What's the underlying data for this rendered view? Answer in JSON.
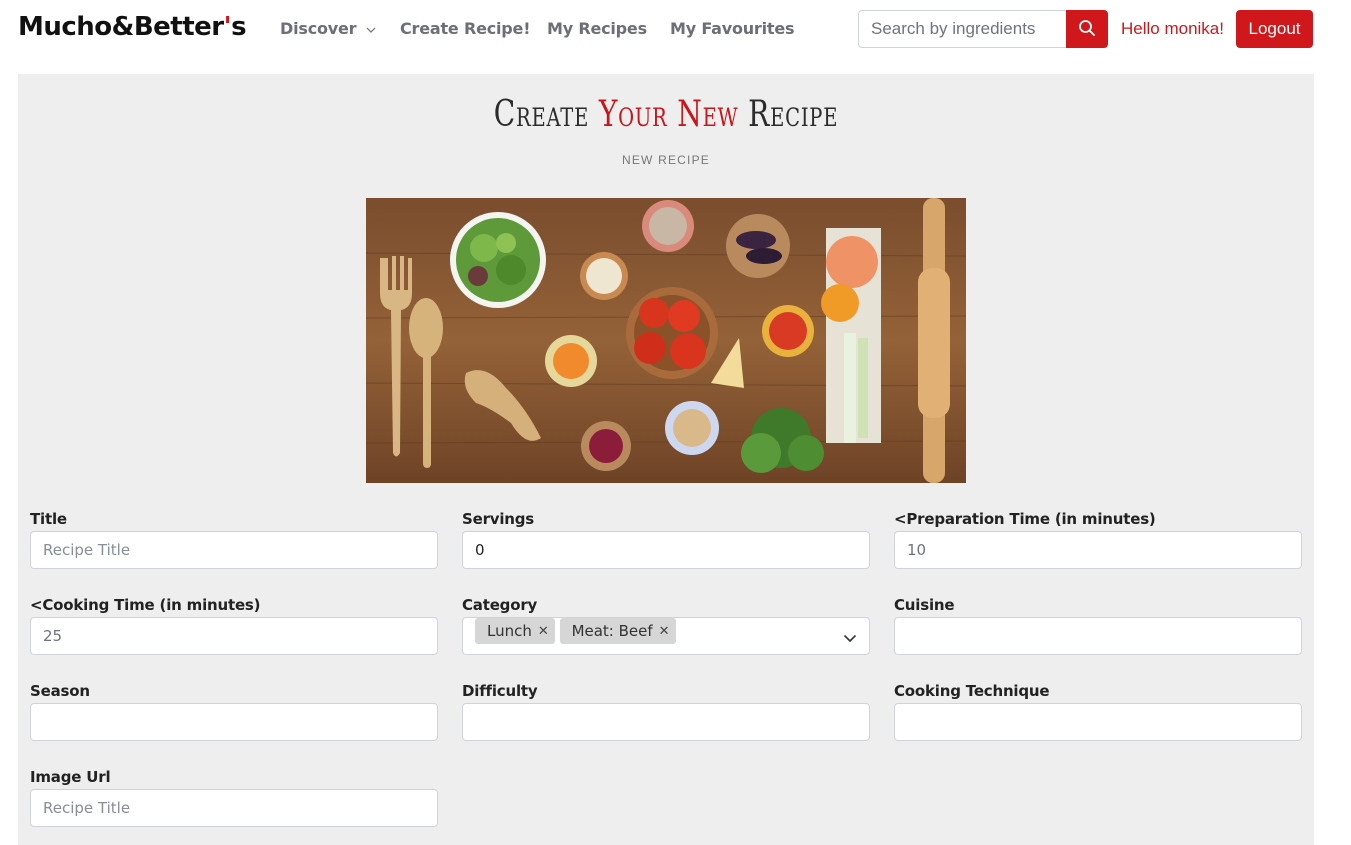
{
  "nav": {
    "brand_main": "Mucho&Better",
    "brand_tick": "'",
    "brand_end": "s",
    "discover": "Discover",
    "create": "Create Recipe!",
    "my_recipes": "My Recipes",
    "favourites": "My Favourites",
    "search_placeholder": "Search by ingredients",
    "greeting": "Hello monika!",
    "logout": "Logout"
  },
  "page": {
    "heading_pre": "Create ",
    "heading_red": "Your New",
    "heading_post": " Recipe",
    "subheading": "NEW RECIPE"
  },
  "form": {
    "title": {
      "label": "Title",
      "placeholder": "Recipe Title",
      "value": ""
    },
    "servings": {
      "label": "Servings",
      "value": "0"
    },
    "prep_time": {
      "label": "<Preparation Time (in minutes)",
      "value": "10"
    },
    "cook_time": {
      "label": "<Cooking Time (in minutes)",
      "value": "25"
    },
    "category": {
      "label": "Category",
      "tags": [
        "Lunch",
        "Meat: Beef"
      ]
    },
    "cuisine": {
      "label": "Cuisine",
      "value": ""
    },
    "season": {
      "label": "Season",
      "value": ""
    },
    "difficulty": {
      "label": "Difficulty",
      "value": ""
    },
    "technique": {
      "label": "Cooking Technique",
      "value": ""
    },
    "image_url": {
      "label": "Image Url",
      "placeholder": "Recipe Title",
      "value": ""
    }
  },
  "icons": {
    "search": "search-icon",
    "discover_chevron": "chevron-down-icon",
    "category_chevron": "chevron-down-icon",
    "tag_remove": "close-icon"
  },
  "colors": {
    "brand_red": "#d0171b",
    "panel_bg": "#eeeeee",
    "nav_text": "#6b6f76"
  }
}
